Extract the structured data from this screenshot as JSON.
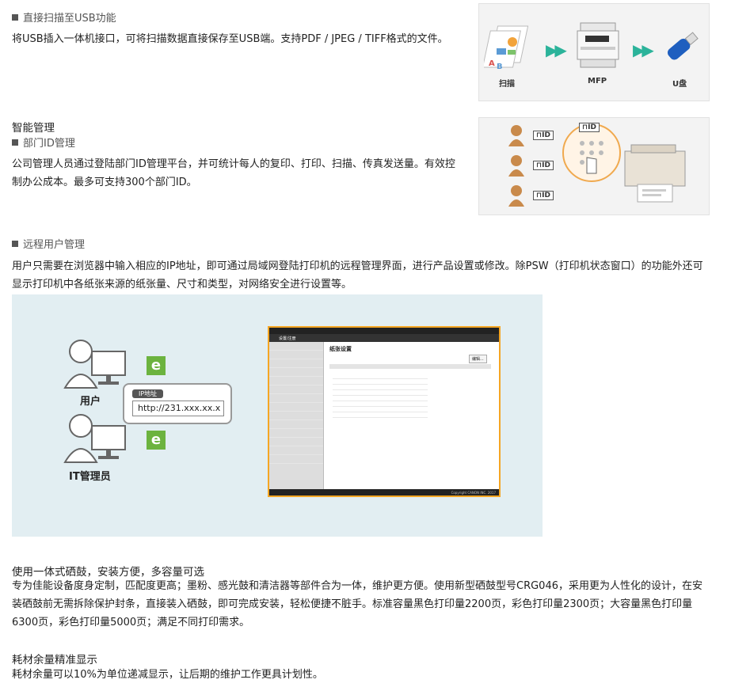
{
  "sections": [
    {
      "type": "square",
      "title": "直接扫描至USB功能",
      "body": "将USB插入一体机接口，可将扫描数据直接保存至USB端。支持PDF / JPEG / TIFF格式的文件。"
    },
    {
      "type": "plain",
      "title": "智能管理"
    },
    {
      "type": "square",
      "title": "部门ID管理",
      "body": "公司管理人员通过登陆部门ID管理平台，并可统计每人的复印、打印、扫描、传真发送量。有效控制办公成本。最多可支持300个部门ID。"
    },
    {
      "type": "square",
      "title": "远程用户管理",
      "body": "用户只需要在浏览器中输入相应的IP地址，即可通过局域网登陆打印机的远程管理界面，进行产品设置或修改。除PSW（打印机状态窗口）的功能外还可显示打印机中各纸张来源的纸张量、尺寸和类型，对网络安全进行设置等。"
    },
    {
      "type": "plain",
      "title": "使用一体式硒鼓，安装方便，多容量可选",
      "body": "专为佳能设备度身定制，匹配度更高；墨粉、感光鼓和清洁器等部件合为一体，维护更方便。使用新型硒鼓型号CRG046，采用更为人性化的设计，在安装硒鼓前无需拆除保护封条，直接装入硒鼓，即可完成安装，轻松便捷不脏手。标准容量黑色打印量2200页，彩色打印量2300页；大容量黑色打印量6300页，彩色打印量5000页；满足不同打印需求。"
    },
    {
      "type": "plain",
      "title": "耗材余量精准显示",
      "body": "耗材余量可以10%为单位递减显示，让后期的维护工作更具计划性。"
    }
  ],
  "fig_usb": {
    "scan": "扫描",
    "mfp": "MFP",
    "usb": "U盘"
  },
  "fig_id": {
    "id_label": "ID"
  },
  "fig_remote": {
    "user": "用户",
    "admin": "IT管理员",
    "ip_label": "IP地址",
    "ip_value": "http://231.xxx.xx.x",
    "e_glyph": "e",
    "screen": {
      "title": "设置/注册",
      "page_title": "纸张设置",
      "edit_btn": "编辑...",
      "footer": "Copyright CANON INC. 2017"
    }
  },
  "colors": {
    "accent_green": "#6cb33f",
    "arrow_teal": "#2bb39a",
    "highlight_orange": "#f5a623"
  }
}
